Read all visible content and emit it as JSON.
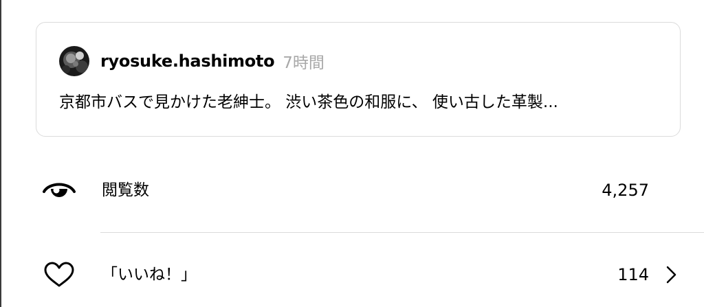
{
  "post": {
    "username": "ryosuke.hashimoto",
    "timestamp": "7時間",
    "text": "京都市バスで見かけた老紳士。 渋い茶色の和服に、 使い古した革製..."
  },
  "stats": {
    "views": {
      "icon": "eye-icon",
      "label": "閲覧数",
      "value": "4,257"
    },
    "likes": {
      "icon": "heart-icon",
      "label": "「いいね！」",
      "value": "114",
      "chevron_icon": "chevron-right-icon"
    }
  },
  "colors": {
    "border": "#dbdbdb",
    "muted_text": "#a8a8a8",
    "text": "#000000"
  }
}
